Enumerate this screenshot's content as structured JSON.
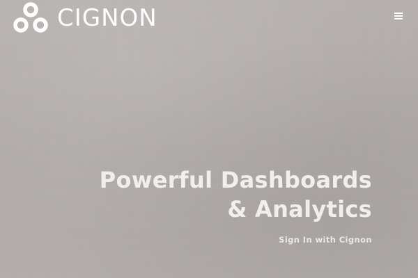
{
  "header": {
    "brand_name": "CIGNON",
    "logo_icon": "cignon-logo-icon",
    "menu_icon": "hamburger-menu-icon"
  },
  "hero": {
    "title": "Powerful Dashboards & Analytics",
    "signin_label": "Sign In with Cignon"
  },
  "colors": {
    "background": "#b2aeac",
    "text_light": "#ffffff",
    "hero_text": "#f1efee"
  }
}
